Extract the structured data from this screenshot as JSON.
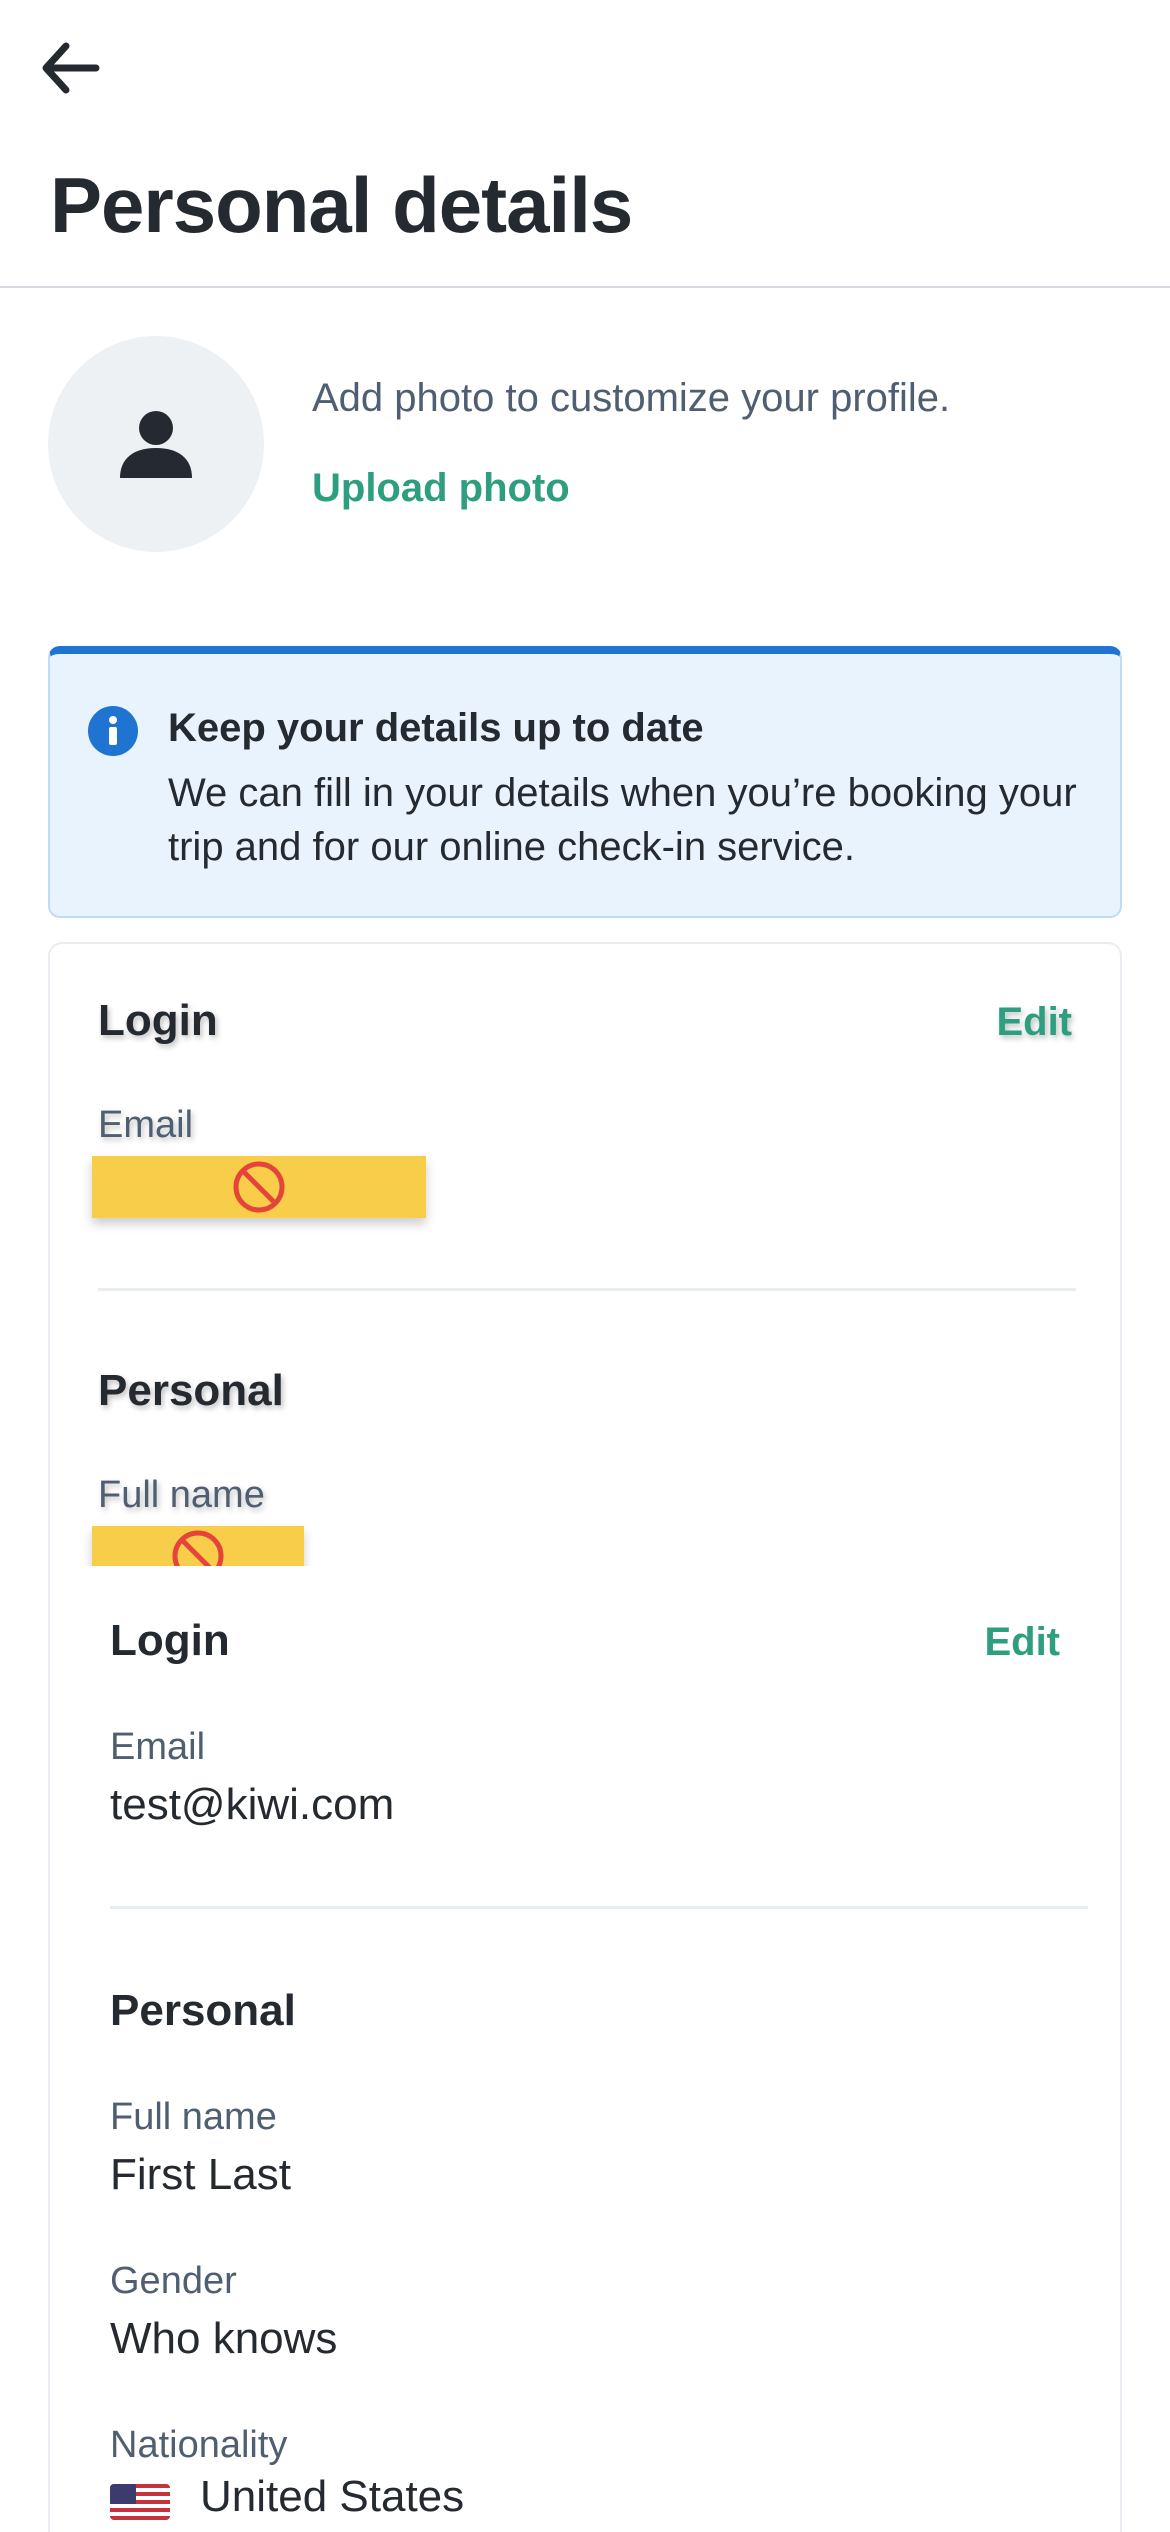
{
  "header": {
    "title": "Personal details"
  },
  "photo": {
    "prompt": "Add photo to customize your profile.",
    "upload_label": "Upload photo"
  },
  "banner": {
    "title": "Keep your details up to date",
    "body": "We can fill in your details when you’re booking your trip and for our online check-in service."
  },
  "login": {
    "title": "Login",
    "edit_label": "Edit",
    "email_label": "Email",
    "email_value": "test@kiwi.com"
  },
  "personal": {
    "title": "Personal",
    "full_name_label": "Full name",
    "full_name_value": "First Last",
    "gender_label": "Gender",
    "gender_value": "Who knows",
    "nationality_label": "Nationality",
    "nationality_value": "United States"
  },
  "colors": {
    "accent": "#2e9e80",
    "info_blue": "#1f74d1",
    "banner_bg": "#e8f3fd",
    "redaction": "#f8cd4a"
  }
}
